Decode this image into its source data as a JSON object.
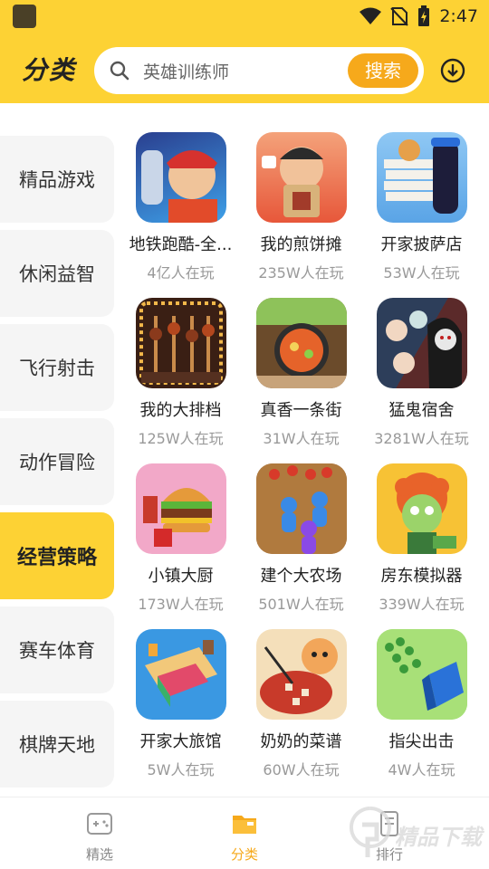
{
  "status_bar": {
    "time": "2:47"
  },
  "header": {
    "title": "分类",
    "search_placeholder": "英雄训练师",
    "search_button": "搜索"
  },
  "categories": [
    {
      "label": "精品游戏",
      "active": false
    },
    {
      "label": "休闲益智",
      "active": false
    },
    {
      "label": "飞行射击",
      "active": false
    },
    {
      "label": "动作冒险",
      "active": false
    },
    {
      "label": "经营策略",
      "active": true
    },
    {
      "label": "赛车体育",
      "active": false
    },
    {
      "label": "棋牌天地",
      "active": false
    }
  ],
  "games": [
    {
      "name": "地铁跑酷-全...",
      "players": "4亿人在玩"
    },
    {
      "name": "我的煎饼摊",
      "players": "235W人在玩"
    },
    {
      "name": "开家披萨店",
      "players": "53W人在玩"
    },
    {
      "name": "我的大排档",
      "players": "125W人在玩"
    },
    {
      "name": "真香一条街",
      "players": "31W人在玩"
    },
    {
      "name": "猛鬼宿舍",
      "players": "3281W人在玩"
    },
    {
      "name": "小镇大厨",
      "players": "173W人在玩"
    },
    {
      "name": "建个大农场",
      "players": "501W人在玩"
    },
    {
      "name": "房东模拟器",
      "players": "339W人在玩"
    },
    {
      "name": "开家大旅馆",
      "players": "5W人在玩"
    },
    {
      "name": "奶奶的菜谱",
      "players": "60W人在玩"
    },
    {
      "name": "指尖出击",
      "players": "4W人在玩"
    }
  ],
  "bottom_nav": [
    {
      "label": "精选",
      "icon": "gamepad-icon",
      "active": false
    },
    {
      "label": "分类",
      "icon": "folder-icon",
      "active": true
    },
    {
      "label": "排行",
      "icon": "ranking-icon",
      "active": false
    }
  ],
  "watermark": {
    "text": "精品下载"
  },
  "colors": {
    "accent": "#fdd234",
    "button": "#f6a91b",
    "text_muted": "#999999"
  }
}
